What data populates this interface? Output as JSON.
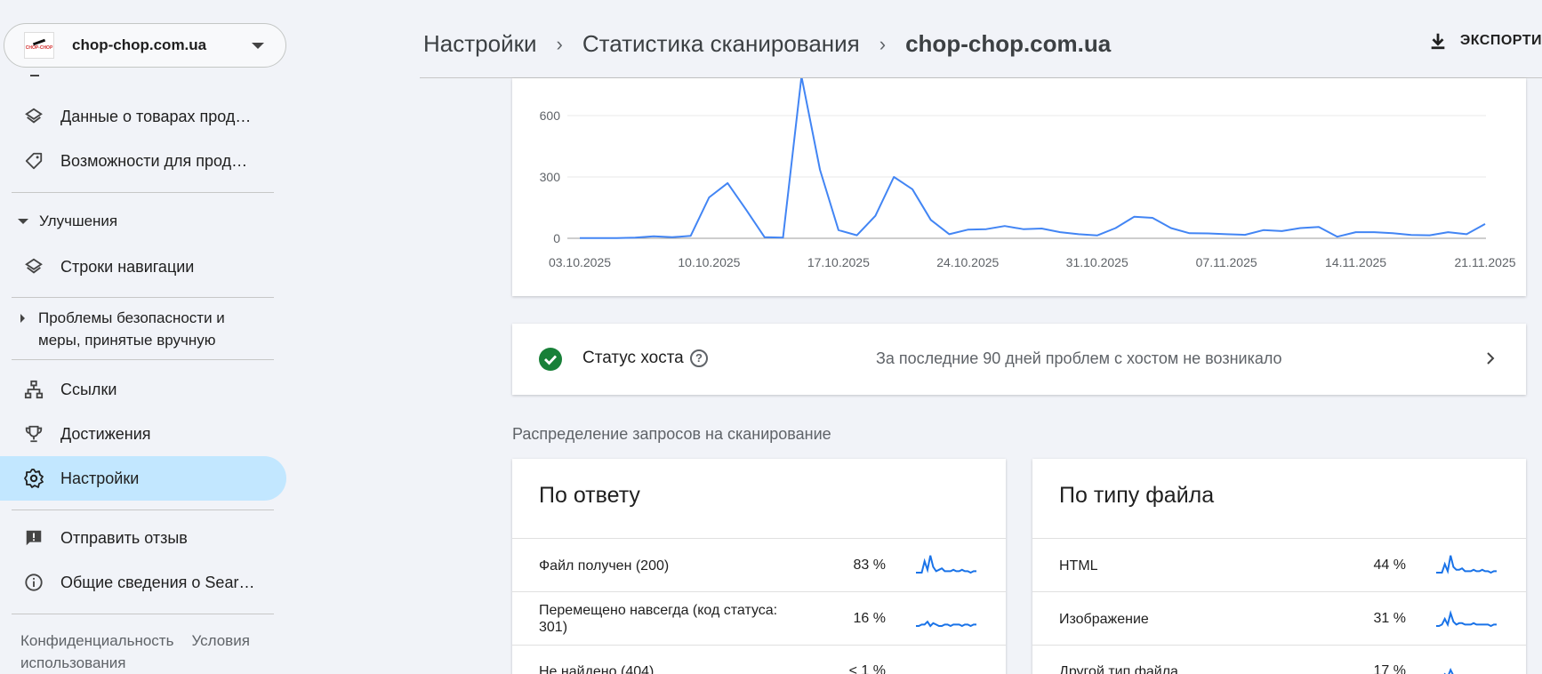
{
  "property": {
    "name": "chop-chop.com.ua",
    "logo_text": "CHOP-CHOP"
  },
  "sidebar": {
    "items_top": [
      {
        "label": "Данные о товарах прод…",
        "icon": "layers-icon"
      },
      {
        "label": "Возможности для прод…",
        "icon": "tag-icon"
      }
    ],
    "section_improvements": "Улучшения",
    "item_breadcrumbs": {
      "label": "Строки навигации",
      "icon": "layers-icon"
    },
    "section_security": "Проблемы безопасности и меры, принятые вручную",
    "items_bottom": [
      {
        "label": "Ссылки",
        "icon": "sitemap-icon"
      },
      {
        "label": "Достижения",
        "icon": "trophy-icon"
      },
      {
        "label": "Настройки",
        "icon": "gear-icon",
        "active": true
      }
    ],
    "items_help": [
      {
        "label": "Отправить отзыв",
        "icon": "feedback-icon"
      },
      {
        "label": "Общие сведения о Sear…",
        "icon": "info-icon"
      }
    ],
    "footer": {
      "privacy": "Конфиденциальность",
      "terms": "Условия использования"
    }
  },
  "header": {
    "crumb_1": "Настройки",
    "crumb_2": "Статистика сканирования",
    "crumb_3": "chop-chop.com.ua",
    "export_label": "ЭКСПОРТИ"
  },
  "chart_data": {
    "type": "line",
    "x_ticks": [
      "03.10.2025",
      "10.10.2025",
      "17.10.2025",
      "24.10.2025",
      "31.10.2025",
      "07.11.2025",
      "14.11.2025",
      "21.11.2025"
    ],
    "y_ticks": [
      0,
      300,
      600
    ],
    "ylim": [
      0,
      900
    ],
    "grid": true,
    "color": "#4285f4",
    "x": [
      "03.10.2025",
      "04.10.2025",
      "05.10.2025",
      "06.10.2025",
      "07.10.2025",
      "08.10.2025",
      "09.10.2025",
      "10.10.2025",
      "11.10.2025",
      "12.10.2025",
      "13.10.2025",
      "14.10.2025",
      "15.10.2025",
      "16.10.2025",
      "17.10.2025",
      "18.10.2025",
      "19.10.2025",
      "20.10.2025",
      "21.10.2025",
      "22.10.2025",
      "23.10.2025",
      "24.10.2025",
      "25.10.2025",
      "26.10.2025",
      "27.10.2025",
      "28.10.2025",
      "29.10.2025",
      "30.10.2025",
      "31.10.2025",
      "01.11.2025",
      "02.11.2025",
      "03.11.2025",
      "04.11.2025",
      "05.11.2025",
      "06.11.2025",
      "07.11.2025",
      "08.11.2025",
      "09.11.2025",
      "10.11.2025",
      "11.11.2025",
      "12.11.2025",
      "13.11.2025",
      "14.11.2025",
      "15.11.2025",
      "16.11.2025",
      "17.11.2025",
      "18.11.2025",
      "19.11.2025",
      "20.11.2025",
      "21.11.2025"
    ],
    "values": [
      1,
      1,
      1,
      3,
      10,
      5,
      12,
      200,
      270,
      140,
      5,
      3,
      800,
      335,
      40,
      15,
      110,
      300,
      240,
      90,
      20,
      42,
      45,
      60,
      45,
      48,
      30,
      20,
      14,
      50,
      105,
      100,
      50,
      25,
      24,
      20,
      17,
      40,
      35,
      50,
      55,
      8,
      30,
      30,
      25,
      16,
      15,
      30,
      20,
      70
    ]
  },
  "host_status": {
    "title": "Статус хоста",
    "message": "За последние 90 дней проблем с хостом не возникало",
    "status_color": "#188038"
  },
  "distribution_title": "Распределение запросов на сканирование",
  "by_response": {
    "title": "По ответу",
    "rows": [
      {
        "label": "Файл получен (200)",
        "pct": "83 %",
        "spark": [
          0,
          0,
          0,
          8,
          2,
          12,
          4,
          1,
          2,
          3,
          1,
          1,
          1,
          2,
          1,
          1,
          2,
          1,
          1,
          0,
          1,
          1
        ]
      },
      {
        "label": "Перемещено навсегда (код статуса: 301)",
        "pct": "16 %",
        "spark": [
          0,
          0,
          1,
          1,
          3,
          0,
          2,
          1,
          0,
          0,
          1,
          1,
          0,
          1,
          1,
          1,
          0,
          1,
          1,
          0,
          1,
          1
        ]
      },
      {
        "label": "Не найдено (404)",
        "pct": "< 1 %",
        "spark": [
          0,
          0,
          0,
          0,
          0,
          0,
          0,
          0,
          0,
          0,
          0,
          0,
          0,
          0,
          0,
          0,
          0,
          0,
          0,
          0,
          0,
          0
        ]
      }
    ]
  },
  "by_filetype": {
    "title": "По типу файла",
    "rows": [
      {
        "label": "HTML",
        "pct": "44 %",
        "spark": [
          0,
          0,
          0,
          6,
          1,
          12,
          4,
          2,
          2,
          3,
          1,
          1,
          1,
          2,
          1,
          1,
          2,
          1,
          1,
          0,
          1,
          1
        ]
      },
      {
        "label": "Изображение",
        "pct": "31 %",
        "spark": [
          0,
          0,
          1,
          5,
          1,
          9,
          3,
          1,
          2,
          2,
          1,
          1,
          1,
          2,
          1,
          1,
          1,
          1,
          1,
          0,
          1,
          1
        ]
      },
      {
        "label": "Другой тип файла",
        "pct": "17 %",
        "spark": [
          0,
          0,
          0,
          3,
          1,
          6,
          2,
          1,
          1,
          2,
          1,
          1,
          1,
          1,
          0,
          1,
          1,
          1,
          0,
          0,
          1,
          1
        ]
      }
    ]
  }
}
